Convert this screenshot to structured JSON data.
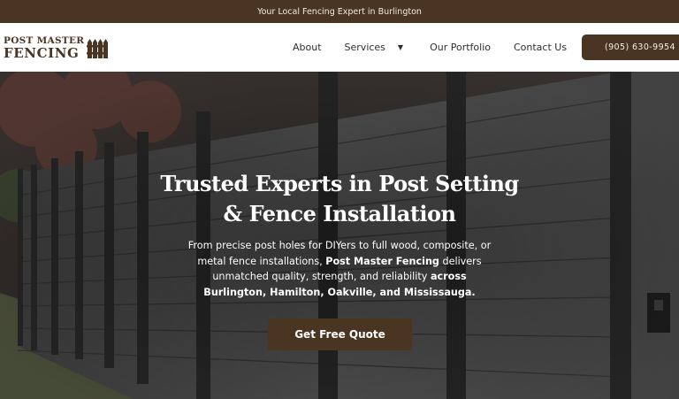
{
  "topbar": {
    "tagline": "Your Local Fencing Expert in Burlington"
  },
  "logo": {
    "line1": "POST MASTER",
    "line2": "FENCING"
  },
  "nav": {
    "items": [
      {
        "label": "About"
      },
      {
        "label": "Services",
        "has_dropdown": true
      },
      {
        "label": "Our Portfolio"
      },
      {
        "label": "Contact Us"
      }
    ],
    "dropdown_caret": "▼"
  },
  "phone": {
    "label": "(905) 630-9954"
  },
  "hero": {
    "title_line1": "Trusted Experts in Post Setting",
    "title_line2": "& Fence Installation",
    "text_part1": "From precise post holes for DIYers to full wood, composite, or metal fence installations, ",
    "text_bold1": "Post Master Fencing",
    "text_part2": " delivers unmatched quality, strength, and reliability ",
    "text_bold2": "across Burlington, Hamilton, Oakville, and Mississauga.",
    "cta_label": "Get Free Quote"
  },
  "colors": {
    "brand_brown": "#4a3422",
    "header_bg": "#ffffff",
    "nav_text": "#2f2f2f",
    "hero_text": "#ffffff"
  },
  "icons": {
    "logo_fence": "fence-icon",
    "dropdown": "chevron-down-icon"
  }
}
